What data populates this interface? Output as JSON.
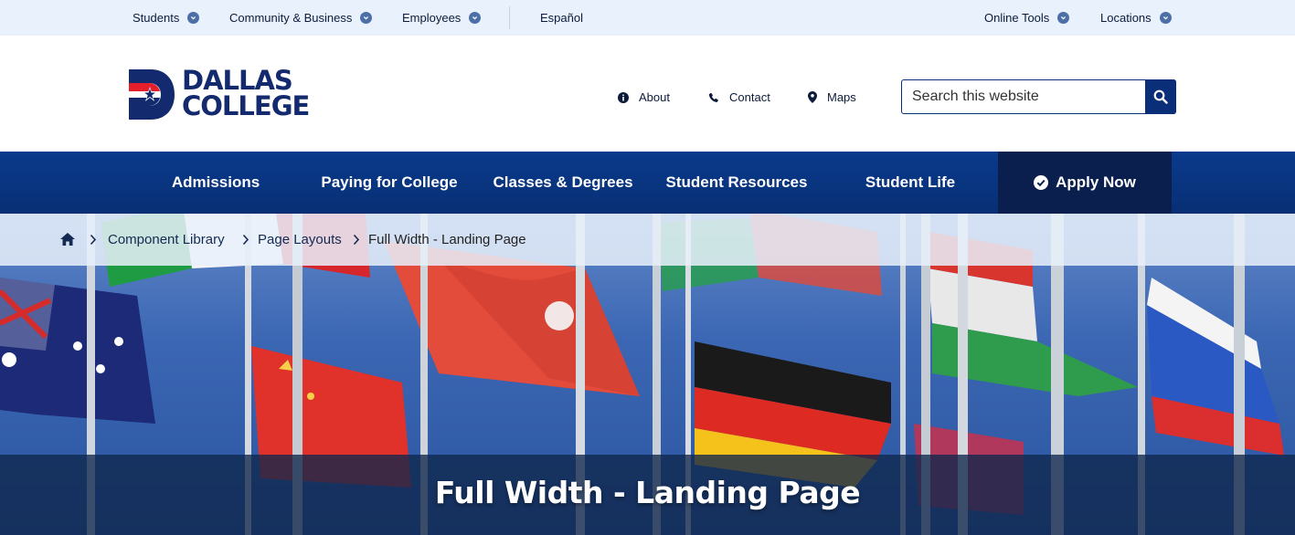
{
  "utility_bar": {
    "items": [
      {
        "label": "Students"
      },
      {
        "label": "Community & Business"
      },
      {
        "label": "Employees"
      }
    ],
    "language": "Español",
    "right_items": [
      {
        "label": "Online Tools"
      },
      {
        "label": "Locations"
      }
    ]
  },
  "header": {
    "logo_line1": "DALLAS",
    "logo_line2": "COLLEGE",
    "links": [
      {
        "label": "About",
        "icon": "info-icon"
      },
      {
        "label": "Contact",
        "icon": "phone-icon"
      },
      {
        "label": "Maps",
        "icon": "map-marker-icon"
      }
    ],
    "search_placeholder": "Search this website"
  },
  "main_nav": {
    "items": [
      {
        "label": "Admissions"
      },
      {
        "label": "Paying for College"
      },
      {
        "label": "Classes & Degrees"
      },
      {
        "label": "Student Resources"
      },
      {
        "label": "Student Life"
      }
    ],
    "apply_label": "Apply Now"
  },
  "breadcrumb": {
    "items": [
      {
        "label": "Component Library"
      },
      {
        "label": "Page Layouts"
      },
      {
        "label": "Full Width - Landing Page"
      }
    ]
  },
  "hero": {
    "title": "Full Width - Landing Page"
  },
  "colors": {
    "brand_navy": "#0a2f78",
    "brand_red": "#e41e2b",
    "utility_bg": "#e8f1fc",
    "apply_bg": "#0a1f4d"
  }
}
